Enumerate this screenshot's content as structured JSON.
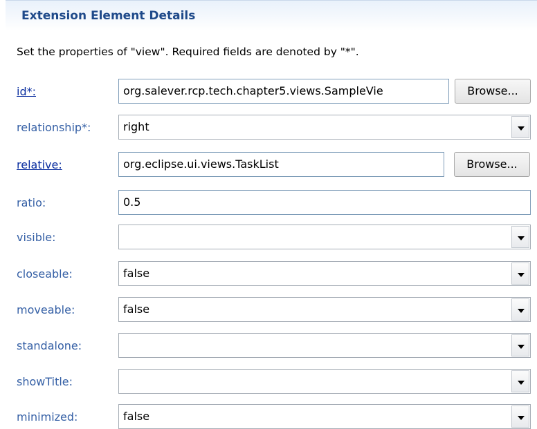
{
  "section": {
    "title": "Extension Element Details"
  },
  "description": "Set the properties of \"view\". Required fields are denoted by \"*\".",
  "fields": {
    "id": {
      "label": "id*:",
      "value": "org.salever.rcp.tech.chapter5.views.SampleVie",
      "browse_label": "Browse..."
    },
    "relationship": {
      "label": "relationship*:",
      "value": "right"
    },
    "relative": {
      "label": "relative:",
      "value": "org.eclipse.ui.views.TaskList",
      "browse_label": "Browse..."
    },
    "ratio": {
      "label": "ratio:",
      "value": "0.5"
    },
    "visible": {
      "label": "visible:",
      "value": ""
    },
    "closeable": {
      "label": "closeable:",
      "value": "false"
    },
    "moveable": {
      "label": "moveable:",
      "value": "false"
    },
    "standalone": {
      "label": "standalone:",
      "value": ""
    },
    "showTitle": {
      "label": "showTitle:",
      "value": ""
    },
    "minimized": {
      "label": "minimized:",
      "value": "false"
    }
  }
}
